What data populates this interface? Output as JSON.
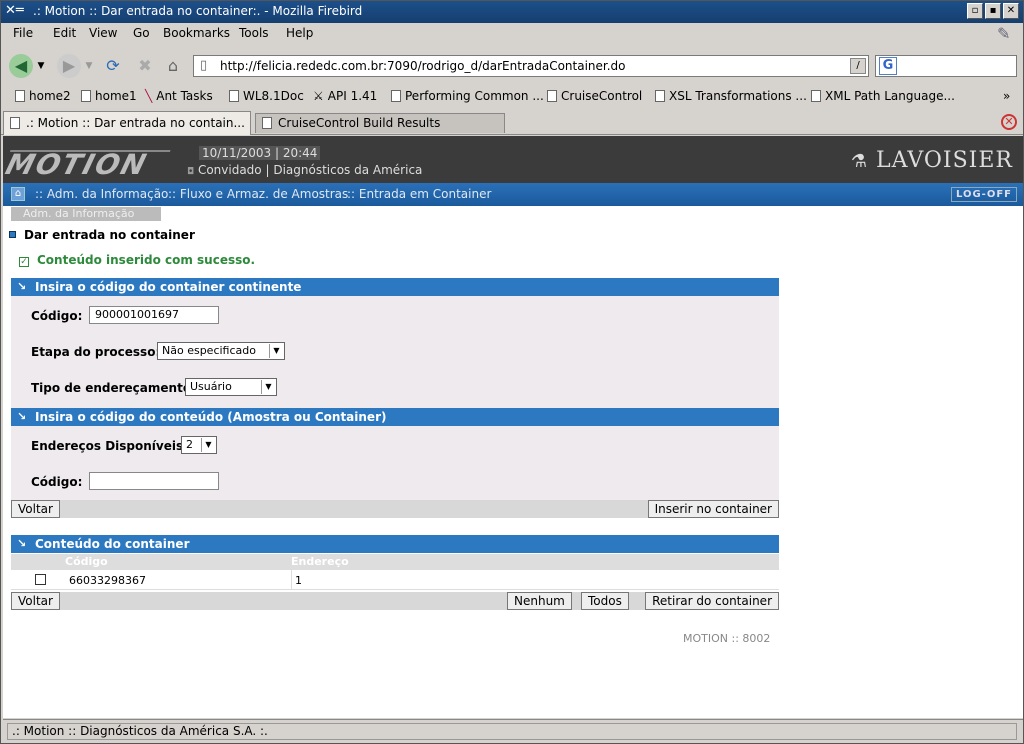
{
  "window": {
    "title": ".: Motion :: Dar entrada no container:. - Mozilla Firebird",
    "controls": [
      "▫",
      "▪",
      "✕"
    ]
  },
  "menu": [
    "File",
    "Edit",
    "View",
    "Go",
    "Bookmarks",
    "Tools",
    "Help"
  ],
  "toolbar": {
    "url": "http://felicia.rededc.com.br:7090/rodrigo_d/darEntradaContainer.do",
    "search_value": ""
  },
  "bookmarks": [
    "home2",
    "home1",
    "Ant Tasks",
    "WL8.1Doc",
    "API 1.41",
    "Performing Common ...",
    "CruiseControl",
    "XSL Transformations ...",
    "XML Path Language...",
    "»"
  ],
  "tabs": [
    {
      "label": ".: Motion :: Dar entrada no contain..."
    },
    {
      "label": "CruiseControl Build Results"
    }
  ],
  "app": {
    "logo": "MOTION",
    "date": "10/11/2003",
    "time": "20:44",
    "user": "Convidado",
    "org": "Diagnósticos da América",
    "brand": "LAVOISIER",
    "breadcrumb": [
      ":: Adm. da Informação",
      ":: Fluxo e Armaz. de Amostras",
      ":: Entrada em Container"
    ],
    "logoff": "LOG-OFF",
    "subtab": "Adm. da Informação",
    "page_title": "Dar entrada no container",
    "success_msg": "Conteúdo inserido com sucesso.",
    "footer_version": "MOTION :: 8002"
  },
  "section1": {
    "title": "Insira o código do container continente",
    "codigo_label": "Código:",
    "codigo_value": "900001001697",
    "etapa_label": "Etapa do processo:",
    "etapa_value": "Não especificado",
    "tipo_label": "Tipo de endereçamento:",
    "tipo_value": "Usuário"
  },
  "section2": {
    "title": "Insira o código do conteúdo (Amostra ou Container)",
    "enderecos_label": "Endereços Disponíveis:",
    "enderecos_value": "2",
    "codigo_label": "Código:",
    "codigo_value": "",
    "voltar": "Voltar",
    "inserir": "Inserir no container"
  },
  "section3": {
    "title": "Conteúdo do container",
    "columns": [
      "Código",
      "Endereço"
    ],
    "rows": [
      {
        "codigo": "66033298367",
        "endereco": "1"
      }
    ],
    "voltar": "Voltar",
    "nenhum": "Nenhum",
    "todos": "Todos",
    "retirar": "Retirar do container"
  },
  "status": ".: Motion :: Diagnósticos da América S.A. :.",
  "colors": {
    "section_header": "#2c79c2",
    "breadcrumb_bar": "#1b5a9c",
    "success": "#2d8a3b",
    "banner": "#3b3b3b"
  }
}
